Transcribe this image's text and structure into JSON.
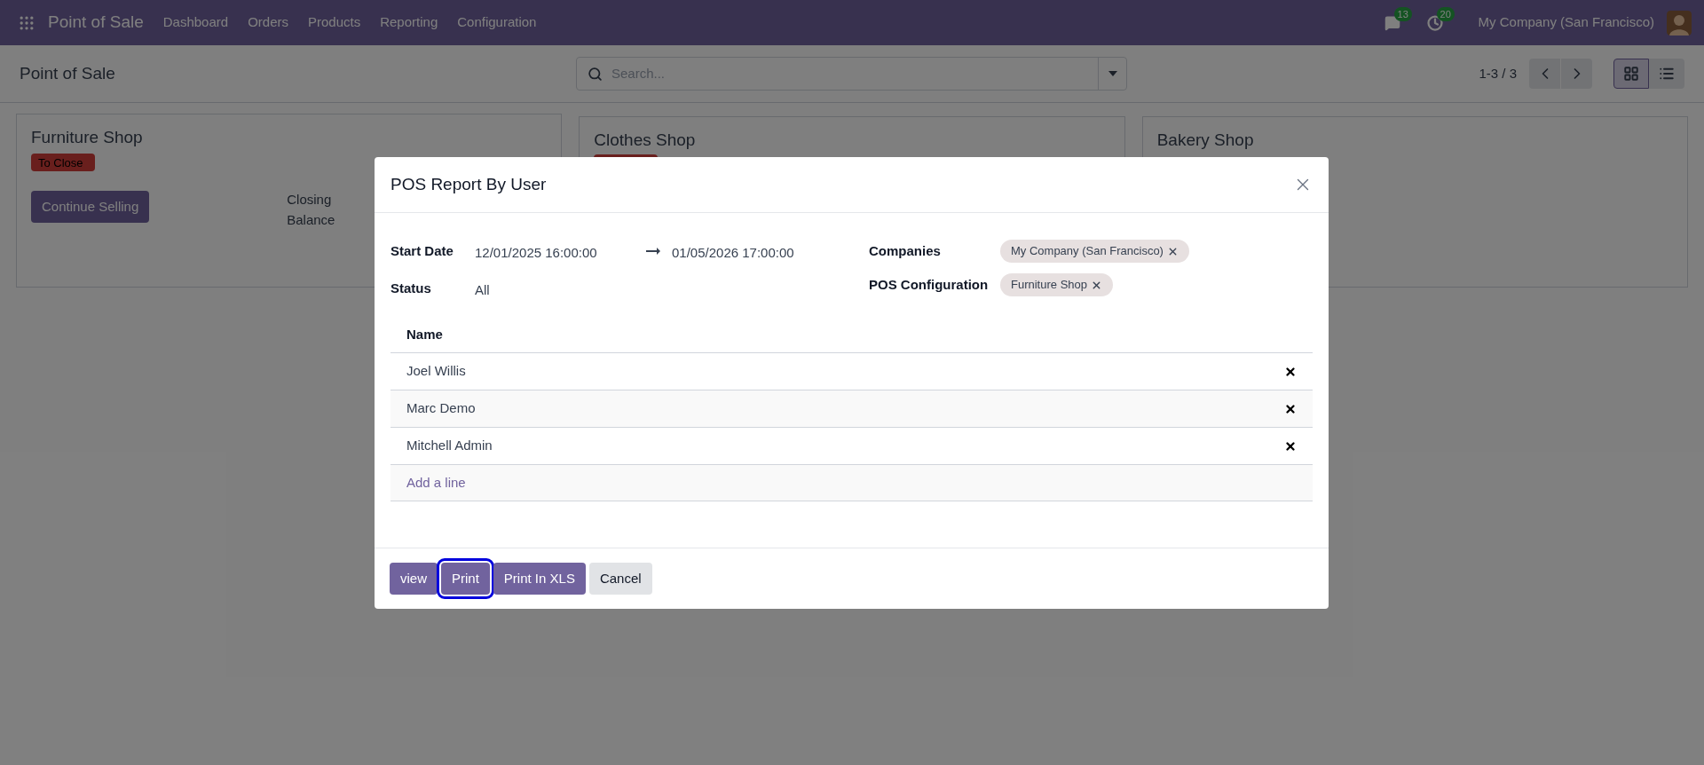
{
  "navbar": {
    "app_name": "Point of Sale",
    "menu": [
      "Dashboard",
      "Orders",
      "Products",
      "Reporting",
      "Configuration"
    ],
    "messages_count": "13",
    "activities_count": "20",
    "company": "My Company (San Francisco)"
  },
  "control_panel": {
    "title": "Point of Sale",
    "search": {
      "placeholder": "Search..."
    },
    "pager": "1-3 / 3",
    "views": [
      {
        "kind": "kanban",
        "selected": true
      },
      {
        "kind": "list",
        "selected": false
      }
    ]
  },
  "shops": [
    {
      "name": "Furniture Shop",
      "badge": {
        "kind": "to_close",
        "label": "To Close"
      },
      "action": "Continue Selling",
      "field_label": "Closing Balance"
    },
    {
      "name": "Clothes Shop",
      "badge": {
        "kind": "to_close"
      }
    },
    {
      "name": "Bakery Shop"
    }
  ],
  "dialog": {
    "title": "POS Report By User",
    "start_date": {
      "label": "Start Date",
      "from": "12/01/2025 16:00:00",
      "to": "01/05/2026 17:00:00"
    },
    "status": {
      "label": "Status",
      "value": "All"
    },
    "companies": {
      "label": "Companies",
      "tags": [
        "My Company (San Francisco)"
      ]
    },
    "pos_configuration": {
      "label": "POS Configuration",
      "tags": [
        "Furniture Shop"
      ]
    },
    "table": {
      "column": "Name",
      "rows": [
        "Joel Willis",
        "Marc Demo",
        "Mitchell Admin"
      ],
      "add_line": "Add a line"
    },
    "buttons": [
      {
        "label": "view",
        "kind": "primary",
        "focused": false
      },
      {
        "label": "Print",
        "kind": "primary",
        "focused": true
      },
      {
        "label": "Print In XLS",
        "kind": "primary",
        "focused": false
      },
      {
        "label": "Cancel",
        "kind": "secondary",
        "focused": false
      }
    ]
  }
}
